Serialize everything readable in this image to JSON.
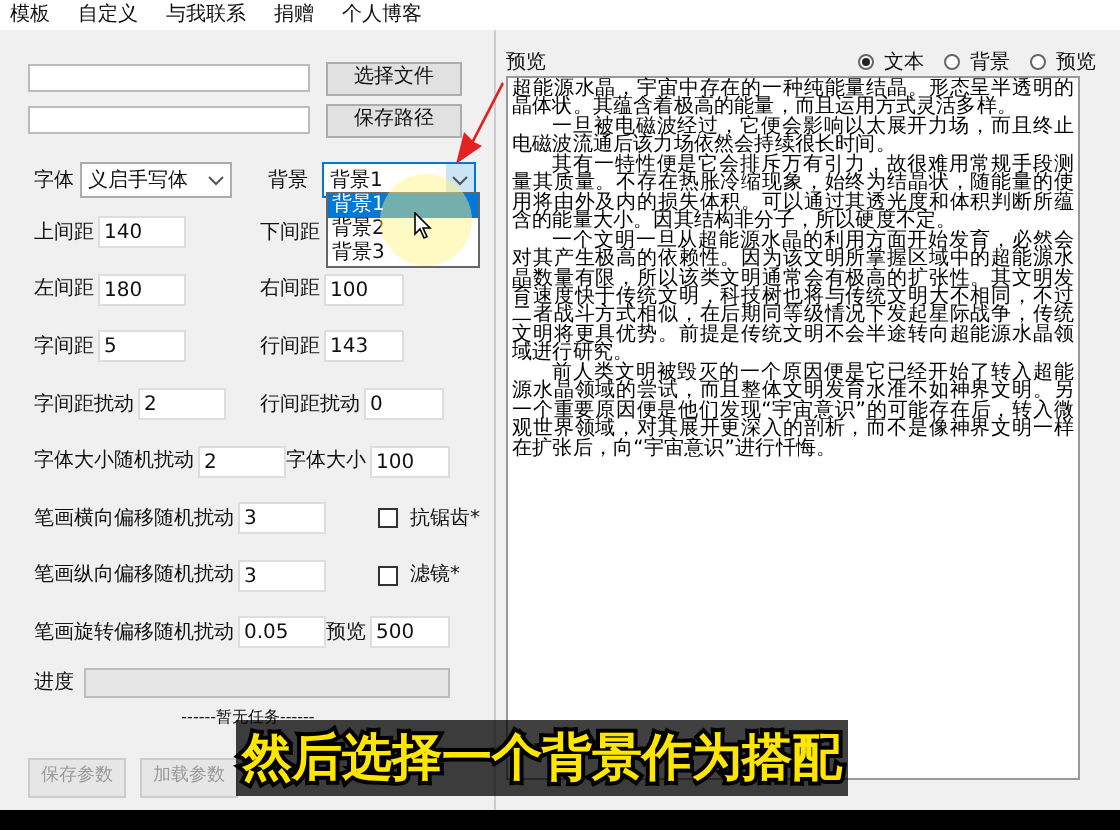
{
  "menu": [
    {
      "label": "模板"
    },
    {
      "label": "自定义"
    },
    {
      "label": "与我联系"
    },
    {
      "label": "捐赠"
    },
    {
      "label": "个人博客"
    }
  ],
  "path_buttons": [
    "选择文件",
    "保存路径"
  ],
  "font": {
    "label": "字体",
    "value": "义启手写体"
  },
  "background": {
    "label": "背景",
    "value": "背景1",
    "expanded": true,
    "options": [
      {
        "label": "背景1",
        "selected": true
      },
      {
        "label": "背景2",
        "selected": false
      },
      {
        "label": "背景3",
        "selected": false
      }
    ]
  },
  "rows": [
    [
      {
        "kind": "field",
        "label": "上间距",
        "value": "140"
      },
      {
        "kind": "field",
        "label": "下间距"
      }
    ],
    [
      {
        "kind": "field",
        "label": "左间距",
        "value": "180"
      },
      {
        "kind": "field",
        "label": "右间距",
        "value": "100"
      }
    ],
    [
      {
        "kind": "field",
        "label": "字间距",
        "value": "5"
      },
      {
        "kind": "field",
        "label": "行间距",
        "value": "143"
      }
    ],
    [
      {
        "kind": "field",
        "label": "字间距扰动",
        "value": "2"
      },
      {
        "kind": "field",
        "label": "行间距扰动",
        "value": "0"
      }
    ],
    [
      {
        "kind": "field",
        "label": "字体大小随机扰动",
        "value": "2"
      },
      {
        "kind": "field",
        "label": "字体大小",
        "value": "100"
      }
    ],
    [
      {
        "kind": "field",
        "label": "笔画横向偏移随机扰动",
        "value": "3"
      },
      {
        "kind": "checkbox",
        "label": "抗锯齿*",
        "checked": false
      }
    ],
    [
      {
        "kind": "field",
        "label": "笔画纵向偏移随机扰动",
        "value": "3"
      },
      {
        "kind": "checkbox",
        "label": "滤镜*",
        "checked": false
      }
    ],
    [
      {
        "kind": "field",
        "label": "笔画旋转偏移随机扰动",
        "value": "0.05"
      },
      {
        "kind": "field",
        "label": "预览",
        "value": "500"
      }
    ]
  ],
  "progress": {
    "label": "进度",
    "level": 0,
    "status": "------暂无任务------"
  },
  "buttons": [
    {
      "label": "保存参数",
      "disabled": true
    },
    {
      "label": "加载参数",
      "disabled": true
    }
  ],
  "preview": {
    "label": "预览",
    "modes": [
      {
        "label": "文本",
        "selected": true
      },
      {
        "label": "背景",
        "selected": false
      },
      {
        "label": "预览",
        "selected": false
      }
    ],
    "paragraphs": [
      "超能源水晶，宇宙中存在的一种纯能量结晶。形态呈半透明的晶体状。其蕴含着极高的能量，而且运用方式灵活多样。",
      "一旦被电磁波经过，它便会影响以太展开力场，而且终止电磁波流通后该力场依然会持续很长时间。",
      "其有一特性便是它会排斥万有引力，故很难用常规手段测量其质量。不存在热胀冷缩现象，始终为结晶状，随能量的使用将由外及内的损失体积。可以通过其透光度和体积判断所蕴含的能量大小。因其结构非分子，所以硬度不定。",
      "一个文明一旦从超能源水晶的利用方面开始发育，必然会对其产生极高的依赖性。因为该文明所掌握区域中的超能源水晶数量有限，所以该类文明通常会有极高的扩张性。其文明发育速度快于传统文明，科技树也将与传统文明大不相同，不过二者战斗方式相似，在后期同等级情况下发起星际战争，传统文明将更具优势。前提是传统文明不会半途转向超能源水晶领域进行研究。",
      "前人类文明被毁灭的一个原因便是它已经开始了转入超能源水晶领域的尝试，而且整体文明发育水准不如神界文明。另一个重要原因便是他们发现“宇宙意识”的可能存在后，转入微观世界领域，对其展开更深入的剖析，而不是像神界文明一样在扩张后，向“宇宙意识”进行忏悔。"
    ]
  },
  "subtitle": "然后选择一个背景作为搭配"
}
